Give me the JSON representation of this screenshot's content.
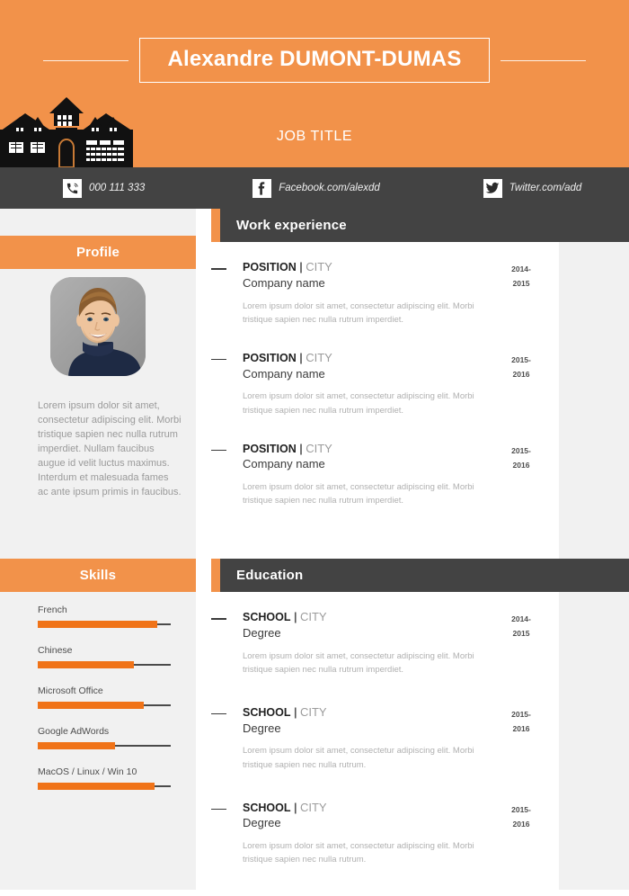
{
  "header": {
    "name": "Alexandre DUMONT-DUMAS",
    "job_title": "JOB TITLE",
    "accent_color": "#F2924A",
    "dark_color": "#434343",
    "building_icon": "mansion-silhouette-icon"
  },
  "contacts": [
    {
      "icon": "phone-icon",
      "text": "000 111 333"
    },
    {
      "icon": "facebook-icon",
      "text": "Facebook.com/alexdd"
    },
    {
      "icon": "twitter-icon",
      "text": "Twitter.com/add"
    }
  ],
  "profile": {
    "heading": "Profile",
    "photo_alt": "profile-photo",
    "text": "Lorem ipsum dolor sit amet, consectetur adipiscing elit. Morbi tristique sapien nec nulla rutrum imperdiet. Nullam faucibus augue id velit luctus maximus. Interdum et malesuada fames ac ante ipsum primis in faucibus."
  },
  "skills": {
    "heading": "Skills",
    "bar_color": "#F07318",
    "items": [
      {
        "label": "French",
        "level": 90
      },
      {
        "label": "Chinese",
        "level": 72
      },
      {
        "label": "Microsoft Office",
        "level": 80
      },
      {
        "label": "Google AdWords",
        "level": 58
      },
      {
        "label": "MacOS / Linux / Win 10",
        "level": 88
      }
    ]
  },
  "work": {
    "heading": "Work experience",
    "entries": [
      {
        "title": "POSITION",
        "separator": "|",
        "city": "CITY",
        "subtitle": "Company name",
        "date_from": "2014-",
        "date_to": "2015",
        "description": "Lorem ipsum dolor sit amet, consectetur adipiscing elit. Morbi tristique sapien nec nulla rutrum imperdiet."
      },
      {
        "title": "POSITION",
        "separator": "|",
        "city": "CITY",
        "subtitle": "Company name",
        "date_from": "2015-",
        "date_to": "2016",
        "description": "Lorem ipsum dolor sit amet, consectetur adipiscing elit. Morbi tristique sapien nec nulla rutrum imperdiet."
      },
      {
        "title": "POSITION",
        "separator": "|",
        "city": "CITY",
        "subtitle": "Company name",
        "date_from": "2015-",
        "date_to": "2016",
        "description": "Lorem ipsum dolor sit amet, consectetur adipiscing elit. Morbi tristique sapien nec nulla rutrum imperdiet."
      }
    ]
  },
  "education": {
    "heading": "Education",
    "entries": [
      {
        "title": "SCHOOL",
        "separator": "|",
        "city": "CITY",
        "subtitle": "Degree",
        "date_from": "2014-",
        "date_to": "2015",
        "description": "Lorem ipsum dolor sit amet, consectetur adipiscing elit. Morbi tristique sapien nec nulla rutrum imperdiet."
      },
      {
        "title": "SCHOOL",
        "separator": "|",
        "city": "CITY",
        "subtitle": "Degree",
        "date_from": "2015-",
        "date_to": "2016",
        "description": "Lorem ipsum dolor sit amet, consectetur adipiscing elit. Morbi tristique sapien nec nulla rutrum."
      },
      {
        "title": "SCHOOL",
        "separator": "|",
        "city": "CITY",
        "subtitle": "Degree",
        "date_from": "2015-",
        "date_to": "2016",
        "description": "Lorem ipsum dolor sit amet, consectetur adipiscing elit. Morbi tristique sapien nec nulla rutrum."
      }
    ]
  }
}
